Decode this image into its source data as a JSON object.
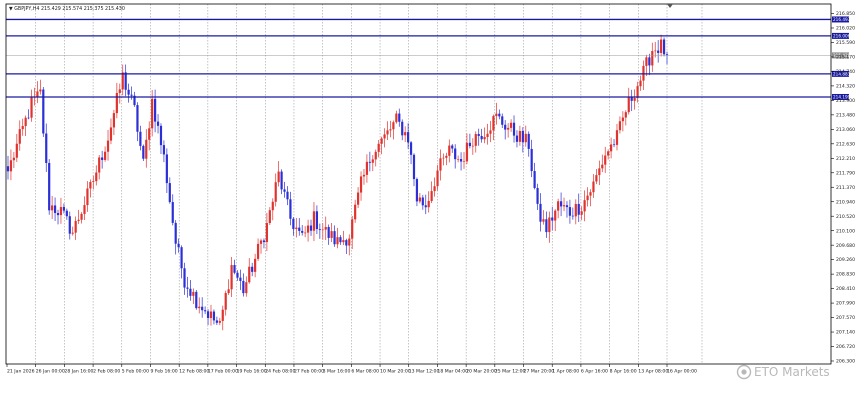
{
  "header": {
    "symbol": "GBPJPY,H4",
    "ohlc": "215.429 215.574 215.375 215.430"
  },
  "watermark": "ETO Markets",
  "colors": {
    "bull": "#e0332e",
    "bear": "#2a2fd6",
    "level_line": "#1a1aa0",
    "grid": "#8a8a8a",
    "frame": "#000000",
    "price_tag": "#1a1aa0"
  },
  "chart_data": {
    "type": "candlestick",
    "title": "",
    "xlabel": "",
    "ylabel": "",
    "ylim": [
      206.3,
      216.95
    ],
    "y_ticks": [
      "216.850",
      "216.020",
      "215.590",
      "215.170",
      "214.740",
      "214.320",
      "213.900",
      "213.480",
      "213.060",
      "212.630",
      "212.210",
      "211.790",
      "211.370",
      "210.940",
      "210.520",
      "210.100",
      "209.680",
      "209.260",
      "208.830",
      "208.410",
      "207.990",
      "207.570",
      "207.140",
      "206.720",
      "206.300"
    ],
    "x_ticks": [
      "21 Jan 2026",
      "26 Jan 00:00",
      "28 Jan 16:00",
      "2 Feb 08:00",
      "5 Feb 00:00",
      "9 Feb 16:00",
      "12 Feb 08:00",
      "17 Feb 00:00",
      "19 Feb 16:00",
      "24 Feb 08:00",
      "27 Feb 00:00",
      "3 Mar 16:00",
      "6 Mar 08:00",
      "10 Mar 20:00",
      "13 Mar 12:00",
      "18 Mar 04:00",
      "20 Mar 20:00",
      "25 Mar 12:00",
      "27 Mar 20:00",
      "1 Apr 08:00",
      "6 Apr 16:00",
      "8 Apr 16:00",
      "13 Apr 08:00",
      "16 Apr 00:00"
    ],
    "levels": [
      {
        "price": 216.493,
        "label": "216.493"
      },
      {
        "price": 216.006,
        "label": "216.006"
      },
      {
        "price": 214.883,
        "label": "214.883"
      },
      {
        "price": 214.199,
        "label": "214.199"
      }
    ],
    "current_price": {
      "price": 215.43,
      "label": "215.430"
    },
    "anchors": [
      [
        0,
        212.0
      ],
      [
        8,
        214.0
      ],
      [
        11,
        214.3
      ],
      [
        14,
        211.0
      ],
      [
        18,
        210.8
      ],
      [
        22,
        210.2
      ],
      [
        28,
        211.5
      ],
      [
        34,
        213.0
      ],
      [
        39,
        214.8
      ],
      [
        43,
        213.8
      ],
      [
        46,
        212.2
      ],
      [
        49,
        214.1
      ],
      [
        53,
        212.4
      ],
      [
        57,
        209.9
      ],
      [
        60,
        208.8
      ],
      [
        64,
        208.2
      ],
      [
        68,
        207.8
      ],
      [
        72,
        207.4
      ],
      [
        76,
        209.2
      ],
      [
        80,
        208.5
      ],
      [
        84,
        209.4
      ],
      [
        88,
        210.4
      ],
      [
        92,
        211.9
      ],
      [
        96,
        210.6
      ],
      [
        100,
        210.0
      ],
      [
        104,
        210.6
      ],
      [
        108,
        210.2
      ],
      [
        112,
        209.9
      ],
      [
        116,
        210.1
      ],
      [
        120,
        211.6
      ],
      [
        124,
        212.6
      ],
      [
        128,
        213.0
      ],
      [
        132,
        213.5
      ],
      [
        136,
        213.0
      ],
      [
        139,
        211.2
      ],
      [
        142,
        211.0
      ],
      [
        146,
        212.0
      ],
      [
        150,
        212.6
      ],
      [
        154,
        212.3
      ],
      [
        158,
        213.0
      ],
      [
        162,
        213.2
      ],
      [
        166,
        213.6
      ],
      [
        170,
        213.3
      ],
      [
        174,
        213.0
      ],
      [
        177,
        212.8
      ],
      [
        180,
        210.8
      ],
      [
        183,
        210.3
      ],
      [
        187,
        211.0
      ],
      [
        191,
        210.8
      ],
      [
        195,
        211.0
      ],
      [
        199,
        211.6
      ],
      [
        203,
        212.5
      ],
      [
        207,
        213.0
      ],
      [
        210,
        213.8
      ],
      [
        213,
        214.4
      ],
      [
        216,
        214.9
      ],
      [
        219,
        215.6
      ],
      [
        222,
        215.7
      ],
      [
        224,
        215.43
      ]
    ]
  }
}
